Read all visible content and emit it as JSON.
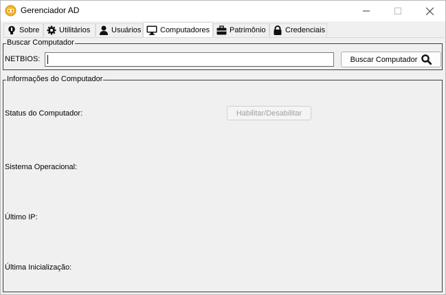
{
  "window": {
    "title": "Gerenciador AD"
  },
  "tabs": [
    {
      "label": "Sobre",
      "icon": "lightbulb-icon"
    },
    {
      "label": "Utilitários",
      "icon": "gear-icon"
    },
    {
      "label": "Usuários",
      "icon": "user-icon"
    },
    {
      "label": "Computadores",
      "icon": "monitor-icon",
      "active": true
    },
    {
      "label": "Patrimônio",
      "icon": "briefcase-icon"
    },
    {
      "label": "Credenciais",
      "icon": "lock-icon"
    }
  ],
  "search_group": {
    "title": "Buscar Computador",
    "field_label": "NETBIOS:",
    "field_value": "",
    "button_label": "Buscar Computador"
  },
  "info_group": {
    "title": "Informações do Computador",
    "status_label": "Status do Computador:",
    "toggle_button_label": "Habilitar/Desabilitar",
    "os_label": "Sistema Operacional:",
    "ip_label": "Último IP:",
    "boot_label": "Última Inicialização:"
  }
}
